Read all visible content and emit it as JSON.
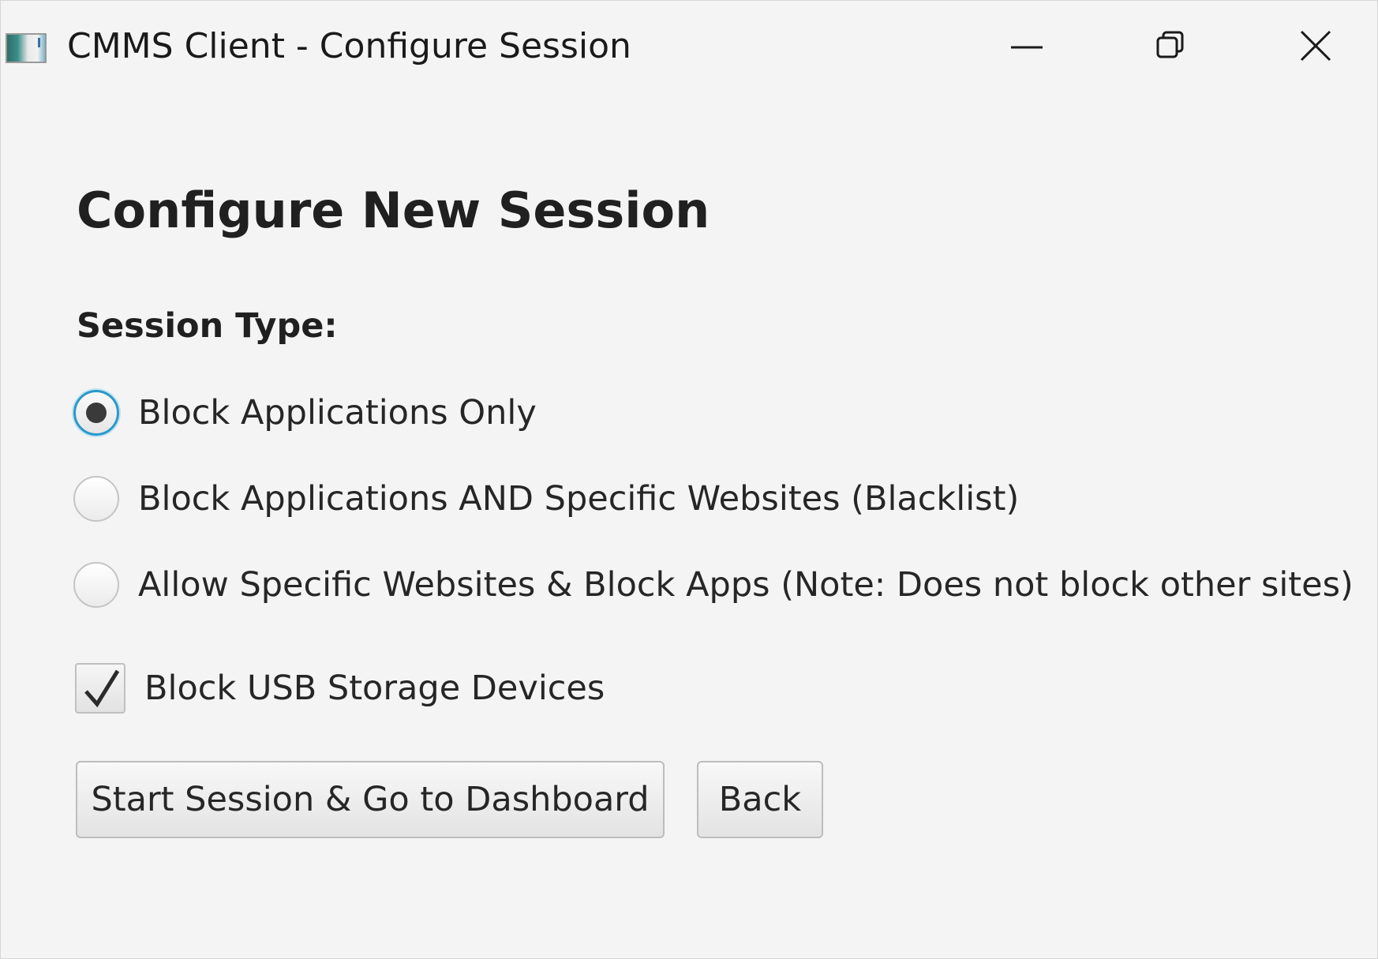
{
  "window": {
    "title": "CMMS Client - Configure Session",
    "controls": [
      "minimize-icon",
      "restore-icon",
      "close-icon"
    ]
  },
  "main": {
    "heading": "Configure New Session",
    "session_type_label": "Session Type:",
    "options": [
      {
        "label": "Block Applications Only",
        "selected": true
      },
      {
        "label": "Block Applications AND Specific Websites (Blacklist)",
        "selected": false
      },
      {
        "label": "Allow Specific Websites & Block Apps (Note: Does not block other sites)",
        "selected": false
      }
    ],
    "usb_checkbox": {
      "label": "Block USB Storage Devices",
      "checked": true
    },
    "buttons": {
      "start": "Start Session & Go to Dashboard",
      "back": "Back"
    }
  },
  "colors": {
    "background": "#f4f4f4",
    "focus_ring": "#2a98c8",
    "text": "#262626"
  }
}
